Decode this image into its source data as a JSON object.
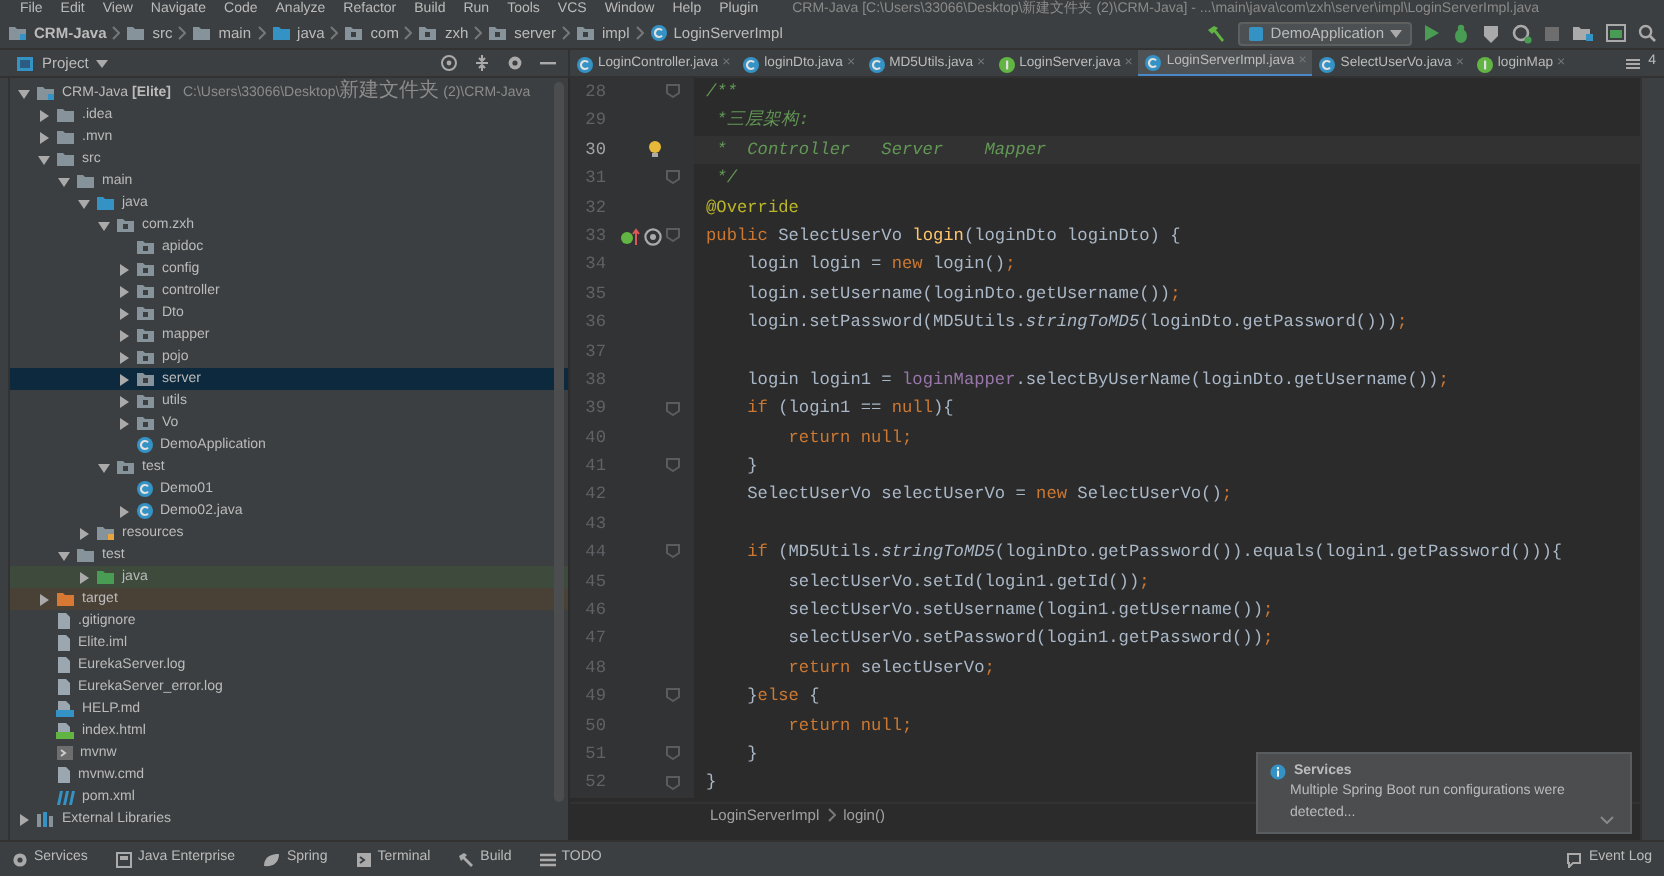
{
  "menu_bar": {
    "items": [
      "File",
      "Edit",
      "View",
      "Navigate",
      "Code",
      "Analyze",
      "Refactor",
      "Build",
      "Run",
      "Tools",
      "VCS",
      "Window",
      "Help",
      "Plugin"
    ],
    "title": "CRM-Java [C:\\Users\\33066\\Desktop\\新建文件夹 (2)\\CRM-Java] - ...\\main\\java\\com\\zxh\\server\\impl\\LoginServerImpl.java"
  },
  "navigation_bar": {
    "crumbs": [
      {
        "label": "CRM-Java",
        "kind": "module"
      },
      {
        "label": "src",
        "kind": "folder"
      },
      {
        "label": "main",
        "kind": "folder"
      },
      {
        "label": "java",
        "kind": "source-folder"
      },
      {
        "label": "com",
        "kind": "package"
      },
      {
        "label": "zxh",
        "kind": "package"
      },
      {
        "label": "server",
        "kind": "package"
      },
      {
        "label": "impl",
        "kind": "package"
      },
      {
        "label": "LoginServerImpl",
        "kind": "class"
      }
    ],
    "run_configuration": "DemoApplication"
  },
  "project_panel": {
    "title": "Project",
    "tree": [
      {
        "label": "CRM-Java **[Elite]**",
        "path": "C:\\Users\\33066\\Desktop\\新建文件夹 (2)\\CRM-Java",
        "kind": "module",
        "expanded": true,
        "selected": false,
        "children": [
          {
            "label": ".idea",
            "kind": "folder",
            "expanded": false,
            "selected": false
          },
          {
            "label": ".mvn",
            "kind": "folder",
            "expanded": false,
            "selected": false
          },
          {
            "label": "src",
            "kind": "folder",
            "expanded": true,
            "selected": false,
            "children": [
              {
                "label": "main",
                "kind": "folder",
                "expanded": true,
                "selected": false,
                "children": [
                  {
                    "label": "java",
                    "kind": "source-folder",
                    "expanded": true,
                    "selected": false,
                    "children": [
                      {
                        "label": "com.zxh",
                        "kind": "package",
                        "expanded": true,
                        "selected": false,
                        "children": [
                          {
                            "label": "apidoc",
                            "kind": "package",
                            "selected": false
                          },
                          {
                            "label": "config",
                            "kind": "package",
                            "expanded": false,
                            "selected": false
                          },
                          {
                            "label": "controller",
                            "kind": "package",
                            "expanded": false,
                            "selected": false
                          },
                          {
                            "label": "Dto",
                            "kind": "package",
                            "expanded": false,
                            "selected": false
                          },
                          {
                            "label": "mapper",
                            "kind": "package",
                            "expanded": false,
                            "selected": false
                          },
                          {
                            "label": "pojo",
                            "kind": "package",
                            "expanded": false,
                            "selected": false
                          },
                          {
                            "label": "server",
                            "kind": "package",
                            "expanded": false,
                            "selected": true
                          },
                          {
                            "label": "utils",
                            "kind": "package",
                            "expanded": false,
                            "selected": false
                          },
                          {
                            "label": "Vo",
                            "kind": "package",
                            "expanded": false,
                            "selected": false
                          },
                          {
                            "label": "DemoApplication",
                            "kind": "class",
                            "selected": false
                          }
                        ]
                      },
                      {
                        "label": "test",
                        "kind": "package",
                        "expanded": true,
                        "selected": false,
                        "children": [
                          {
                            "label": "Demo01",
                            "kind": "class",
                            "selected": false
                          },
                          {
                            "label": "Demo02.java",
                            "kind": "class",
                            "expanded": false,
                            "selected": false
                          }
                        ]
                      }
                    ]
                  },
                  {
                    "label": "resources",
                    "kind": "resources",
                    "expanded": false,
                    "selected": false
                  }
                ]
              },
              {
                "label": "test",
                "kind": "folder",
                "expanded": true,
                "selected": false,
                "children": [
                  {
                    "label": "java",
                    "kind": "test-source",
                    "expanded": false,
                    "selected": false
                  }
                ]
              }
            ]
          },
          {
            "label": "target",
            "kind": "excluded",
            "expanded": false,
            "selected": false
          },
          {
            "label": ".gitignore",
            "kind": "file",
            "selected": false
          },
          {
            "label": "Elite.iml",
            "kind": "file",
            "selected": false
          },
          {
            "label": "EurekaServer.log",
            "kind": "file",
            "selected": false
          },
          {
            "label": "EurekaServer_error.log",
            "kind": "file",
            "selected": false
          },
          {
            "label": "HELP.md",
            "kind": "markdown",
            "selected": false
          },
          {
            "label": "index.html",
            "kind": "html",
            "selected": false
          },
          {
            "label": "mvnw",
            "kind": "script",
            "selected": false
          },
          {
            "label": "mvnw.cmd",
            "kind": "file",
            "selected": false
          },
          {
            "label": "pom.xml",
            "kind": "maven",
            "selected": false
          }
        ]
      },
      {
        "label": "External Libraries",
        "kind": "libraries",
        "expanded": false,
        "selected": false
      }
    ]
  },
  "editor_tabs": [
    {
      "label": "LoginController.java",
      "kind": "class",
      "selected": false,
      "close": "×"
    },
    {
      "label": "loginDto.java",
      "kind": "class",
      "selected": false,
      "close": "×"
    },
    {
      "label": "MD5Utils.java",
      "kind": "class",
      "selected": false,
      "close": "×"
    },
    {
      "label": "LoginServer.java",
      "kind": "interface",
      "selected": false,
      "close": "×"
    },
    {
      "label": "LoginServerImpl.java",
      "kind": "class",
      "selected": true,
      "close": "×"
    },
    {
      "label": "SelectUserVo.java",
      "kind": "class",
      "selected": false,
      "close": "×"
    },
    {
      "label": "loginMap",
      "kind": "interface",
      "selected": false,
      "close": "×"
    }
  ],
  "tab_overflow": "4",
  "editor": {
    "lines": [
      {
        "number": "28",
        "current": false,
        "fold": true,
        "segments": [
          {
            "text": "/**",
            "kind": "doc"
          }
        ]
      },
      {
        "number": "29",
        "current": false,
        "fold": false,
        "segments": [
          {
            "text": " *三层架构:",
            "kind": "doc"
          }
        ]
      },
      {
        "number": "30",
        "current": true,
        "fold": false,
        "gutter_icons": [
          {
            "kind": "bulb"
          }
        ],
        "segments": [
          {
            "text": " *  Controller   Server    Mapper",
            "kind": "doc"
          }
        ]
      },
      {
        "number": "31",
        "current": false,
        "fold": true,
        "segments": [
          {
            "text": " */",
            "kind": "doc"
          }
        ]
      },
      {
        "number": "32",
        "current": false,
        "fold": false,
        "segments": [
          {
            "text": "@Override",
            "kind": "annotation"
          }
        ]
      },
      {
        "number": "33",
        "current": false,
        "fold": true,
        "gutter_icons": [
          {
            "kind": "implements"
          },
          {
            "kind": "at"
          }
        ],
        "segments": [
          {
            "text": "public",
            "kind": "keyword"
          },
          {
            "text": " SelectUserVo ",
            "kind": "plain"
          },
          {
            "text": "login",
            "kind": "method"
          },
          {
            "text": "(loginDto loginDto) {",
            "kind": "plain"
          }
        ]
      },
      {
        "number": "34",
        "current": false,
        "fold": false,
        "segments": [
          {
            "text": "    login login = ",
            "kind": "plain"
          },
          {
            "text": "new",
            "kind": "keyword"
          },
          {
            "text": " login()",
            "kind": "plain"
          },
          {
            "text": ";",
            "kind": "keyword"
          }
        ]
      },
      {
        "number": "35",
        "current": false,
        "fold": false,
        "segments": [
          {
            "text": "    login.setUsername(loginDto.getUsername())",
            "kind": "plain"
          },
          {
            "text": ";",
            "kind": "keyword"
          }
        ]
      },
      {
        "number": "36",
        "current": false,
        "fold": false,
        "segments": [
          {
            "text": "    login.setPassword(MD5Utils.",
            "kind": "plain"
          },
          {
            "text": "stringToMD5",
            "kind": "static"
          },
          {
            "text": "(loginDto.getPassword()))",
            "kind": "plain"
          },
          {
            "text": ";",
            "kind": "keyword"
          }
        ]
      },
      {
        "number": "37",
        "current": false,
        "fold": false
      },
      {
        "number": "38",
        "current": false,
        "fold": false,
        "segments": [
          {
            "text": "    login login1 = ",
            "kind": "plain"
          },
          {
            "text": "loginMapper",
            "kind": "field"
          },
          {
            "text": ".selectByUserName(loginDto.getUsername())",
            "kind": "plain"
          },
          {
            "text": ";",
            "kind": "keyword"
          }
        ]
      },
      {
        "number": "39",
        "current": false,
        "fold": true,
        "segments": [
          {
            "text": "    if",
            "kind": "keyword"
          },
          {
            "text": " (login1 == ",
            "kind": "plain"
          },
          {
            "text": "null",
            "kind": "keyword"
          },
          {
            "text": "){",
            "kind": "plain"
          }
        ]
      },
      {
        "number": "40",
        "current": false,
        "fold": false,
        "segments": [
          {
            "text": "        return null;",
            "kind": "keyword"
          }
        ]
      },
      {
        "number": "41",
        "current": false,
        "fold": true,
        "segments": [
          {
            "text": "    }",
            "kind": "plain"
          }
        ]
      },
      {
        "number": "42",
        "current": false,
        "fold": false,
        "segments": [
          {
            "text": "    SelectUserVo selectUserVo = ",
            "kind": "plain"
          },
          {
            "text": "new",
            "kind": "keyword"
          },
          {
            "text": " SelectUserVo()",
            "kind": "plain"
          },
          {
            "text": ";",
            "kind": "keyword"
          }
        ]
      },
      {
        "number": "43",
        "current": false,
        "fold": false
      },
      {
        "number": "44",
        "current": false,
        "fold": true,
        "segments": [
          {
            "text": "    if",
            "kind": "keyword"
          },
          {
            "text": " (MD5Utils.",
            "kind": "plain"
          },
          {
            "text": "stringToMD5",
            "kind": "static"
          },
          {
            "text": "(loginDto.getPassword()).equals(login1.getPassword())){",
            "kind": "plain"
          }
        ]
      },
      {
        "number": "45",
        "current": false,
        "fold": false,
        "segments": [
          {
            "text": "        selectUserVo.setId(login1.getId())",
            "kind": "plain"
          },
          {
            "text": ";",
            "kind": "keyword"
          }
        ]
      },
      {
        "number": "46",
        "current": false,
        "fold": false,
        "segments": [
          {
            "text": "        selectUserVo.setUsername(login1.getUsername())",
            "kind": "plain"
          },
          {
            "text": ";",
            "kind": "keyword"
          }
        ]
      },
      {
        "number": "47",
        "current": false,
        "fold": false,
        "segments": [
          {
            "text": "        selectUserVo.setPassword(login1.getPassword())",
            "kind": "plain"
          },
          {
            "text": ";",
            "kind": "keyword"
          }
        ]
      },
      {
        "number": "48",
        "current": false,
        "fold": false,
        "segments": [
          {
            "text": "        return",
            "kind": "keyword"
          },
          {
            "text": " selectUserVo",
            "kind": "plain"
          },
          {
            "text": ";",
            "kind": "keyword"
          }
        ]
      },
      {
        "number": "49",
        "current": false,
        "fold": true,
        "segments": [
          {
            "text": "    }",
            "kind": "plain"
          },
          {
            "text": "else",
            "kind": "keyword"
          },
          {
            "text": " {",
            "kind": "plain"
          }
        ]
      },
      {
        "number": "50",
        "current": false,
        "fold": false,
        "segments": [
          {
            "text": "        return null;",
            "kind": "keyword"
          }
        ]
      },
      {
        "number": "51",
        "current": false,
        "fold": true,
        "segments": [
          {
            "text": "    }",
            "kind": "plain"
          }
        ]
      },
      {
        "number": "52",
        "current": false,
        "fold": true,
        "segments": [
          {
            "text": "}",
            "kind": "plain"
          }
        ]
      }
    ],
    "breadcrumb": [
      "LoginServerImpl",
      "login()"
    ]
  },
  "notification": {
    "title": "Services",
    "message": "Multiple Spring Boot run configurations were detected..."
  },
  "status_bar": {
    "tools": [
      {
        "label": "Services",
        "kind": "services"
      },
      {
        "label": "Java Enterprise",
        "kind": "enterprise"
      },
      {
        "label": "Spring",
        "kind": "spring"
      },
      {
        "label": "Terminal",
        "kind": "terminal"
      },
      {
        "label": "Build",
        "kind": "build"
      },
      {
        "label": "TODO",
        "kind": "todo"
      }
    ],
    "event_log": "Event Log"
  }
}
